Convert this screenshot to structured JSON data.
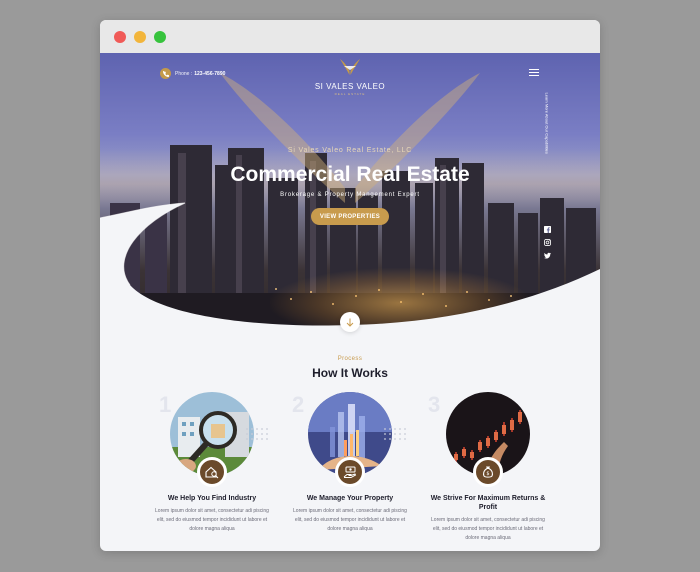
{
  "header": {
    "phone_label": "Phone :",
    "phone_number": "123-456-7890",
    "logo_name": "SI VALES VALEO",
    "logo_sub": "REAL ESTATE",
    "side_text": "Learn More About Our Capabilities",
    "social_icons": [
      "facebook-icon",
      "instagram-icon",
      "twitter-icon"
    ]
  },
  "hero": {
    "company": "Si Vales Valeo Real Estate, LLC",
    "headline": "Commercial Real Estate",
    "tagline": "Brokerage & Property Mangement Expert",
    "cta_label": "VIEW PROPERTIES"
  },
  "process": {
    "label": "Process",
    "title": "How It Works",
    "steps": [
      {
        "number": "1",
        "title": "We Help You Find Industry",
        "description": "Lorem ipsum dolor sit amet, consectetur adi piscing elit, sed do eiusmod tempor incididunt ut labore et dolore magna aliqua",
        "icon": "house-search-icon"
      },
      {
        "number": "2",
        "title": "We Manage Your Property",
        "description": "Lorem ipsum dolor sit amet, consectetur adi piscing elit, sed do eiusmod tempor incididunt ut labore et dolore magna aliqua",
        "icon": "hand-money-icon"
      },
      {
        "number": "3",
        "title": "We Strive For Maximum Returns & Profit",
        "description": "Lorem ipsum dolor sit amet, consectetur adi piscing elit, sed do eiusmod tempor incididunt ut labore et dolore magna aliqua",
        "icon": "money-bag-icon"
      }
    ]
  },
  "colors": {
    "accent": "#c89b4d",
    "badge": "#6b4a2a",
    "heading": "#1d1d2b"
  }
}
